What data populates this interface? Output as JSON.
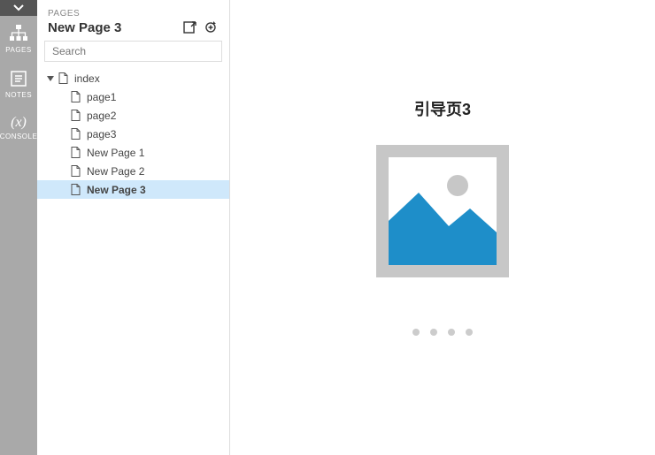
{
  "toolbar": {
    "items": [
      {
        "name": "pages",
        "label": "PAGES"
      },
      {
        "name": "notes",
        "label": "NOTES"
      },
      {
        "name": "console",
        "label": "CONSOLE",
        "symbol": "(x)"
      }
    ]
  },
  "panel": {
    "title": "PAGES",
    "current_page": "New Page 3",
    "search_placeholder": "Search"
  },
  "tree": {
    "root": {
      "label": "index",
      "expanded": true,
      "children": [
        {
          "label": "page1",
          "selected": false
        },
        {
          "label": "page2",
          "selected": false
        },
        {
          "label": "page3",
          "selected": false
        },
        {
          "label": "New Page 1",
          "selected": false
        },
        {
          "label": "New Page 2",
          "selected": false
        },
        {
          "label": "New Page 3",
          "selected": true
        }
      ]
    }
  },
  "canvas": {
    "title": "引导页3",
    "placeholder_colors": {
      "frame": "#c7c7c7",
      "mountain": "#1e8ec9",
      "sun": "#c7c7c7"
    },
    "dots_count": 4
  }
}
